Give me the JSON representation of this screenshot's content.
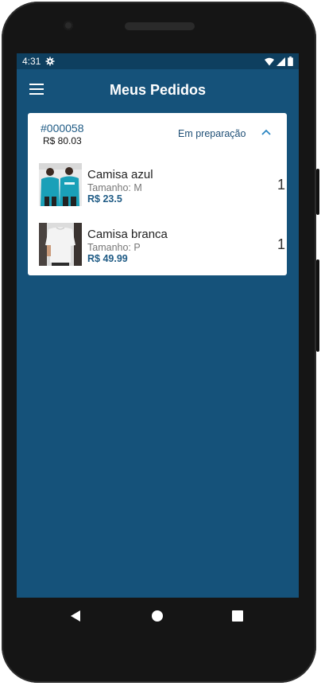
{
  "status_bar": {
    "time": "4:31",
    "icons": [
      "settings-icon",
      "wifi-icon",
      "signal-icon",
      "battery-icon"
    ]
  },
  "app_bar": {
    "title": "Meus Pedidos",
    "menu_icon": "hamburger-menu-icon"
  },
  "order": {
    "id": "#000058",
    "total": "R$ 80.03",
    "status": "Em preparação",
    "expanded_icon": "chevron-up-icon",
    "items": [
      {
        "name": "Camisa azul",
        "size": "Tamanho: M",
        "price": "R$ 23.5",
        "quantity": "1"
      },
      {
        "name": "Camisa branca",
        "size": "Tamanho: P",
        "price": "R$ 49.99",
        "quantity": "1"
      }
    ]
  },
  "nav_bar": {
    "icons": [
      "back-icon",
      "home-icon",
      "recents-icon"
    ]
  },
  "colors": {
    "app_background": "#15527a",
    "status_bar": "#0e3f5f",
    "accent": "#1f5b85"
  }
}
